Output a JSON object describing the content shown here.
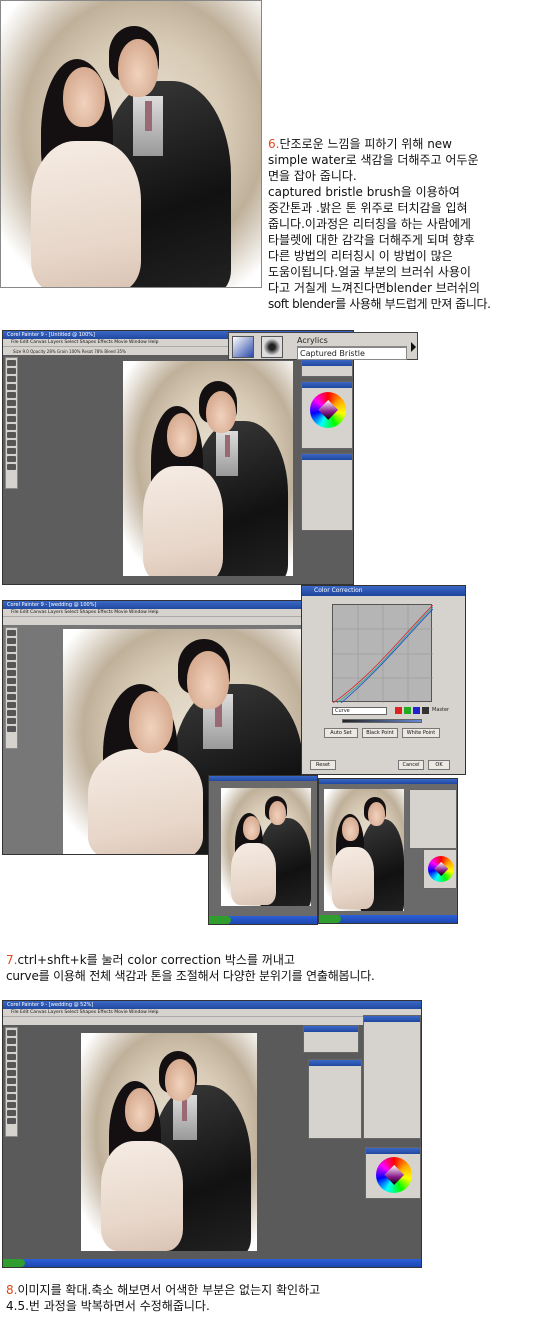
{
  "step6": {
    "number": "6.",
    "lines": [
      "단조로운 느낌을 피하기 위해 new",
      "simple water로 색감을 더해주고 어두운",
      "면을 잡아 줍니다.",
      "captured bristle brush을 이용하여",
      "중간톤과 .밝은 톤 위주로 터치감을 입혀",
      "줍니다.이과정은  리터칭을 하는 사람에게",
      "타블렛에 대한 감각을 더해주게 되며 향후",
      "다른 방법의 리터칭시 이 방법이 많은",
      "도움이됩니다.얼굴 부분의 브러쉬 사용이",
      "다고 거칠게 느껴진다면blender 브러쉬의",
      "soft blender를 사용해 부드럽게 만져 줍니다."
    ]
  },
  "brush_selector": {
    "category": "Acrylics",
    "variant": "Captured Bristle"
  },
  "screenshot1": {
    "title": "Corel Painter 9 - [Untitled @ 100%]",
    "menus": "File  Edit  Canvas  Layers  Select  Shapes  Effects  Movie  Window  Help",
    "props": "Size  9.0   Opacity  28%   Grain  100%   Resat  78%   Bleed  35%"
  },
  "screenshot2": {
    "title": "Corel Painter 9 - [wedding @ 100%]",
    "menus": "File  Edit  Canvas  Layers  Select  Shapes  Effects  Movie  Window  Help"
  },
  "color_correction": {
    "title": "Color Correction",
    "mode_value": "Curve",
    "master_label": "Master",
    "buttons": {
      "auto_set": "Auto Set",
      "black_point": "Black Point",
      "white_point": "White Point",
      "reset": "Reset",
      "cancel": "Cancel",
      "ok": "OK"
    }
  },
  "step7": {
    "number": "7.",
    "line1": "ctrl+shft+k를 눌러 color correction 박스를 꺼내고",
    "line2": "curve를 이용해 전체 색감과 톤을 조절해서 다양한 분위기를 연출해봅니다."
  },
  "screenshot3": {
    "title": "Corel Painter 9 - [wedding @ 52%]",
    "menus": "File  Edit  Canvas  Layers  Select  Shapes  Effects  Movie  Window  Help"
  },
  "step8": {
    "number": "8.",
    "line1": "이미지를 확대.축소 해보면서 어색한 부분은 없는지 확인하고",
    "line2": "4.5.번 과정을  박복하면서  수정해줍니다."
  },
  "colors": {
    "step_number": "#e0481c",
    "titlebar": "#2a56b8",
    "app_workspace": "#5d5d5d",
    "panel": "#d6d3ce"
  }
}
